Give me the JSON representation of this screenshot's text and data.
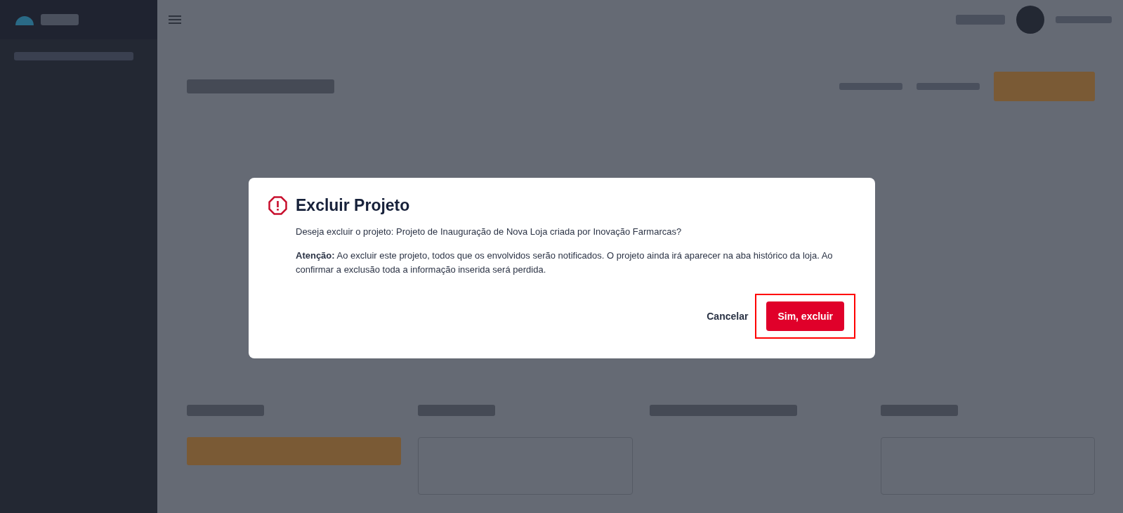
{
  "dialog": {
    "title": "Excluir Projeto",
    "question": "Deseja excluir o projeto: Projeto de Inauguração de Nova Loja criada por Inovação Farmarcas?",
    "warning": "**Atenção:** Ao excluir este projeto, todos que os envolvidos serão notificados. O projeto ainda irá aparecer na aba histórico da loja. Ao confirmar a exclusão toda a informação inserida será perdida.",
    "cancel": "Cancelar",
    "confirm": {
      "label": "Sim, excluir",
      "highlighted": true
    }
  }
}
